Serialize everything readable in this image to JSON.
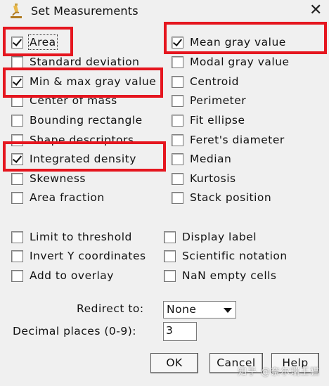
{
  "window": {
    "title": "Set Measurements"
  },
  "measurements": {
    "area": {
      "label": "Area",
      "checked": true
    },
    "standard_deviation": {
      "label": "Standard deviation",
      "checked": false
    },
    "min_max": {
      "label": "Min & max gray value",
      "checked": true
    },
    "center_of_mass": {
      "label": "Center of mass",
      "checked": false
    },
    "bounding_rectangle": {
      "label": "Bounding rectangle",
      "checked": false
    },
    "shape_descriptors": {
      "label": "Shape descriptors",
      "checked": false
    },
    "integrated_density": {
      "label": "Integrated density",
      "checked": true
    },
    "skewness": {
      "label": "Skewness",
      "checked": false
    },
    "area_fraction": {
      "label": "Area fraction",
      "checked": false
    },
    "mean_gray_value": {
      "label": "Mean gray value",
      "checked": true
    },
    "modal_gray_value": {
      "label": "Modal gray value",
      "checked": false
    },
    "centroid": {
      "label": "Centroid",
      "checked": false
    },
    "perimeter": {
      "label": "Perimeter",
      "checked": false
    },
    "fit_ellipse": {
      "label": "Fit ellipse",
      "checked": false
    },
    "ferets_diameter": {
      "label": "Feret's diameter",
      "checked": false
    },
    "median": {
      "label": "Median",
      "checked": false
    },
    "kurtosis": {
      "label": "Kurtosis",
      "checked": false
    },
    "stack_position": {
      "label": "Stack position",
      "checked": false
    }
  },
  "options": {
    "limit_to_threshold": {
      "label": "Limit to threshold",
      "checked": false
    },
    "invert_y": {
      "label": "Invert Y coordinates",
      "checked": false
    },
    "add_to_overlay": {
      "label": "Add to overlay",
      "checked": false
    },
    "display_label": {
      "label": "Display label",
      "checked": false
    },
    "scientific_notation": {
      "label": "Scientific notation",
      "checked": false
    },
    "nan_empty_cells": {
      "label": "NaN empty cells",
      "checked": false
    }
  },
  "redirect": {
    "label": "Redirect to:",
    "value": "None"
  },
  "decimal": {
    "label": "Decimal places (0-9):",
    "value": "3"
  },
  "buttons": {
    "ok": "OK",
    "cancel": "Cancel",
    "help": "Help"
  },
  "watermark": "知乎 @奈尔瑞王猫",
  "colors": {
    "highlight": "#e5161f",
    "background": "#f0f0f0"
  }
}
